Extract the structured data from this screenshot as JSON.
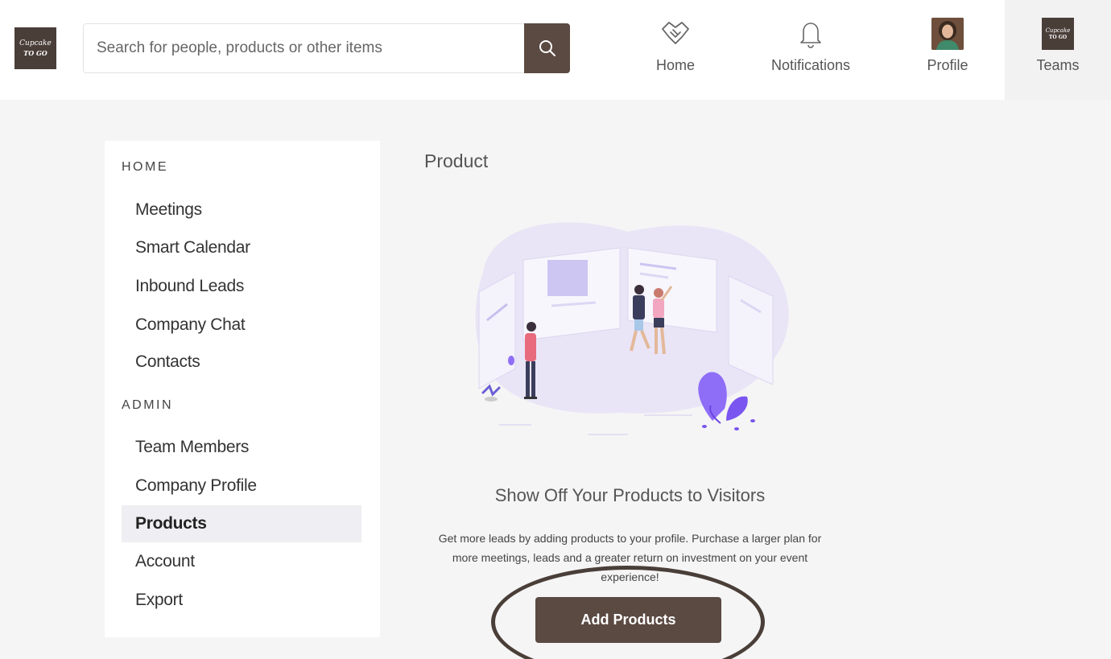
{
  "header": {
    "logo": {
      "line1": "Cupcake",
      "line2": "TO GO"
    },
    "search": {
      "placeholder": "Search for people, products or other items"
    },
    "nav": {
      "home": {
        "label": "Home",
        "icon": "handshake-icon"
      },
      "notifications": {
        "label": "Notifications",
        "icon": "bell-icon"
      },
      "profile": {
        "label": "Profile",
        "icon": "avatar"
      },
      "teams": {
        "label": "Teams",
        "icon": "team-logo"
      }
    }
  },
  "sidebar": {
    "home_heading": "HOME",
    "home_items": [
      "Meetings",
      "Smart Calendar",
      "Inbound Leads",
      "Company Chat",
      "Contacts"
    ],
    "admin_heading": "ADMIN",
    "admin_items": [
      "Team Members",
      "Company Profile",
      "Products",
      "Account",
      "Export"
    ],
    "active_item": "Products"
  },
  "main": {
    "title": "Product",
    "headline": "Show Off Your Products to Visitors",
    "description": "Get more leads by adding products to your profile. Purchase a larger plan for more meetings, leads and a greater return on investment on your event experience!",
    "add_button": "Add Products"
  },
  "colors": {
    "accent": "#5b4a42",
    "illustration": "#8f6ef7",
    "sidebar_active": "#efeef2"
  }
}
